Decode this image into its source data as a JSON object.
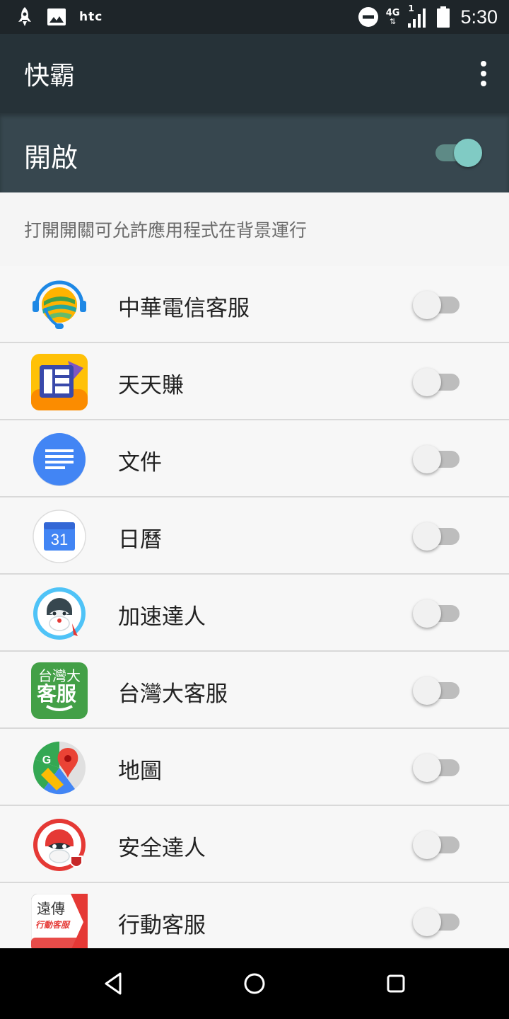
{
  "status_bar": {
    "carrier": "htc",
    "network_top": "4G",
    "network_sim": "1",
    "time": "5:30",
    "icons": [
      "notification-rocket-icon",
      "gallery-image-icon",
      "do-not-disturb-icon",
      "signal-icon",
      "battery-icon"
    ]
  },
  "app_bar": {
    "title": "快霸",
    "menu_icon": "overflow-menu-icon"
  },
  "master_switch": {
    "label": "開啟",
    "checked": true,
    "accent": "#80cbc4"
  },
  "description": "打開開關可允許應用程式在背景運行",
  "apps": [
    {
      "name": "中華電信客服",
      "icon": "cht-service-icon",
      "enabled": false
    },
    {
      "name": "天天賺",
      "icon": "tiantianzhuan-icon",
      "enabled": false
    },
    {
      "name": "文件",
      "icon": "google-docs-icon",
      "enabled": false
    },
    {
      "name": "日曆",
      "icon": "google-calendar-icon",
      "calendar_day": "31",
      "enabled": false
    },
    {
      "name": "加速達人",
      "icon": "speed-booster-icon",
      "enabled": false
    },
    {
      "name": "台灣大客服",
      "icon": "taiwan-mobile-service-icon",
      "badge_line1": "台灣大",
      "badge_line2": "客服",
      "enabled": false
    },
    {
      "name": "地圖",
      "icon": "google-maps-icon",
      "enabled": false
    },
    {
      "name": "安全達人",
      "icon": "security-master-icon",
      "enabled": false
    },
    {
      "name": "行動客服",
      "icon": "fetnet-service-icon",
      "badge_line1": "遠傳",
      "badge_line2": "行動客服",
      "enabled": false
    }
  ],
  "nav_bar": {
    "back_icon": "back-icon",
    "home_icon": "home-icon",
    "recents_icon": "recents-icon"
  }
}
